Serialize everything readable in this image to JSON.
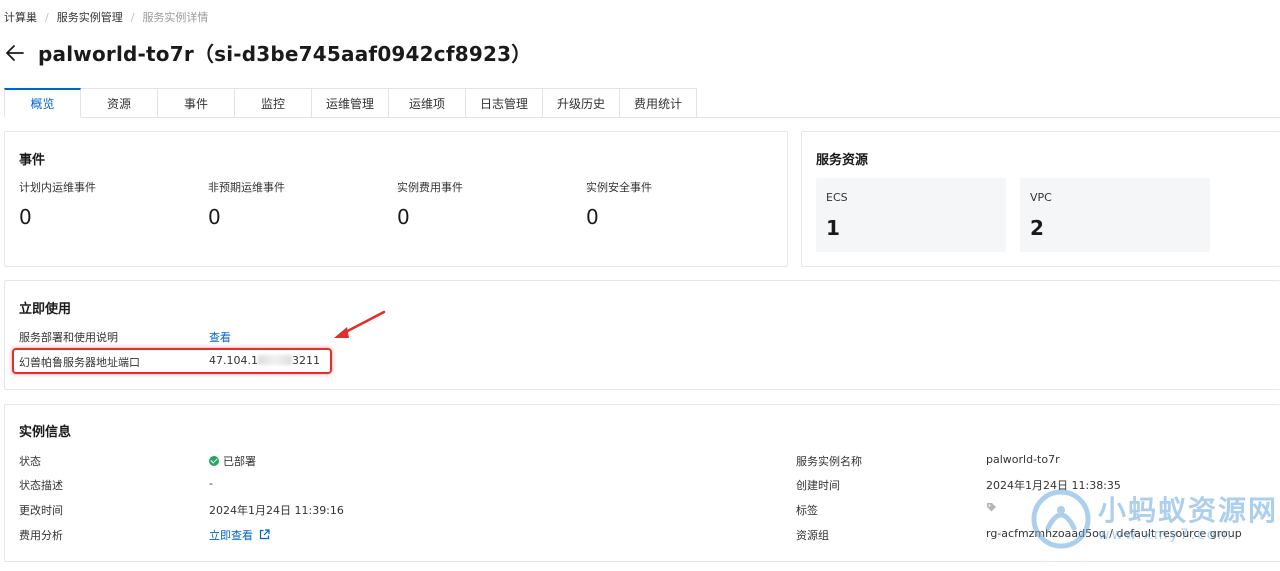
{
  "breadcrumb": {
    "item1": "计算巢",
    "item2": "服务实例管理",
    "item3": "服务实例详情"
  },
  "title": "palworld-to7r（si-d3be745aaf0942cf8923）",
  "tabs": [
    "概览",
    "资源",
    "事件",
    "监控",
    "运维管理",
    "运维项",
    "日志管理",
    "升级历史",
    "费用统计"
  ],
  "events": {
    "title": "事件",
    "items": [
      {
        "label": "计划内运维事件",
        "value": "0"
      },
      {
        "label": "非预期运维事件",
        "value": "0"
      },
      {
        "label": "实例费用事件",
        "value": "0"
      },
      {
        "label": "实例安全事件",
        "value": "0"
      }
    ]
  },
  "resources": {
    "title": "服务资源",
    "items": [
      {
        "label": "ECS",
        "value": "1"
      },
      {
        "label": "VPC",
        "value": "2"
      }
    ]
  },
  "quick_use": {
    "title": "立即使用",
    "deploy_label": "服务部署和使用说明",
    "deploy_link": "查看",
    "address_label": "幻兽帕鲁服务器地址端口",
    "address_prefix": "47.104.1",
    "address_suffix": "3211"
  },
  "instance_info": {
    "title": "实例信息",
    "status_label": "状态",
    "status_value": "已部署",
    "status_desc_label": "状态描述",
    "status_desc_value": "-",
    "modified_label": "更改时间",
    "modified_value": "2024年1月24日 11:39:16",
    "cost_label": "费用分析",
    "cost_link": "立即查看",
    "name_label": "服务实例名称",
    "name_value": "palworld-to7r",
    "created_label": "创建时间",
    "created_value": "2024年1月24日 11:38:35",
    "tags_label": "标签",
    "rg_label": "资源组",
    "rg_value": "rg-acfmzmhzoaad5oq / default resource group"
  },
  "watermark": {
    "cn": "小蚂蚁资源网",
    "url": "www.xmy7.com"
  },
  "colors": {
    "accent": "#0064c8",
    "highlight": "#e0302c",
    "success": "#22a95f"
  }
}
